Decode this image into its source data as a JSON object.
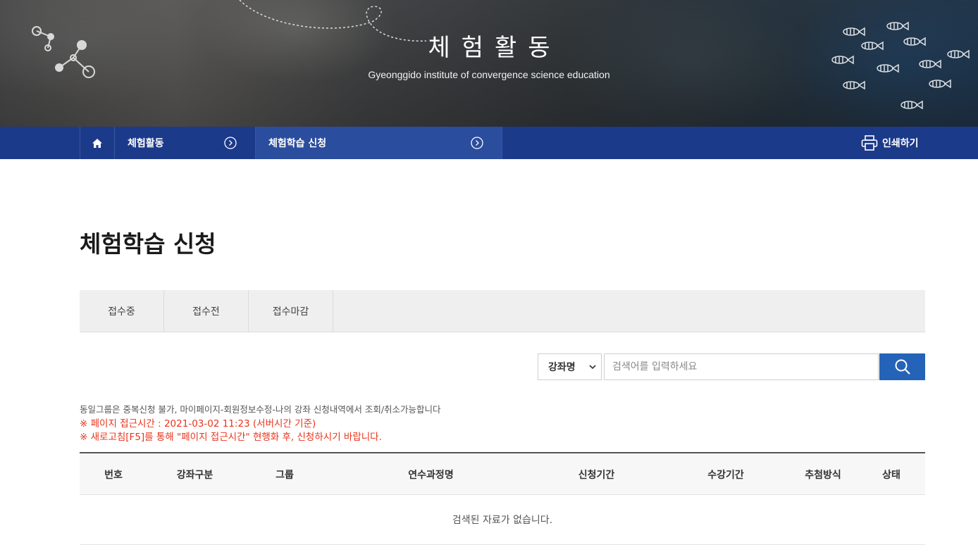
{
  "banner": {
    "title": "체험활동",
    "subtitle": "Gyeonggido institute of convergence science education"
  },
  "location": {
    "home_icon": "home-icon",
    "items": [
      {
        "label": "체험활동"
      },
      {
        "label": "체험학습 신청"
      }
    ],
    "print_label": "인쇄하기",
    "print_icon": "printer-icon"
  },
  "page": {
    "title": "체험학습 신청"
  },
  "tabs": [
    {
      "label": "접수중"
    },
    {
      "label": "접수전"
    },
    {
      "label": "접수마감"
    }
  ],
  "search": {
    "select_value": "강좌명",
    "placeholder": "검색어를 입력하세요",
    "button_icon": "search-icon"
  },
  "notices": {
    "info": "동일그룹은 중복신청 불가, 마이페이지-회원정보수정-나의 강좌 신청내역에서 조회/취소가능합니다",
    "access_time": "※ 페이지 접근시간 : 2021-03-02 11:23 (서버시간 기준)",
    "refresh": "※ 새로고침[F5]를 통해 \"페이지 접근시간\" 현행화 후, 신청하시기 바랍니다."
  },
  "table": {
    "headers": [
      "번호",
      "강좌구분",
      "그룹",
      "연수과정명",
      "신청기간",
      "수강기간",
      "추첨방식",
      "상태"
    ],
    "empty_message": "검색된 자료가 없습니다."
  },
  "colors": {
    "nav_bar": "#1c3a8a",
    "active_segment": "#2b4d9e",
    "search_button": "#2563b8",
    "notice_red": "#e8341c"
  }
}
